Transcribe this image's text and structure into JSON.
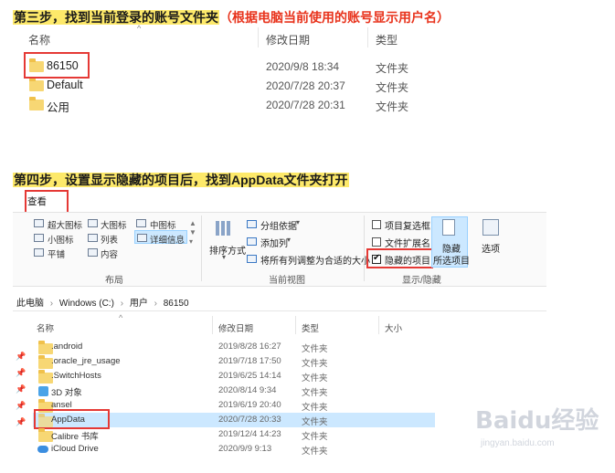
{
  "step3": {
    "title": "第三步，找到当前登录的账号文件夹",
    "note": "（根据电脑当前使用的账号显示用户名）"
  },
  "explorer1": {
    "columns": {
      "name": "名称",
      "date": "修改日期",
      "type": "类型"
    },
    "rows": [
      {
        "name": "86150",
        "date": "2020/9/8 18:34",
        "type": "文件夹"
      },
      {
        "name": "Default",
        "date": "2020/7/28 20:37",
        "type": "文件夹"
      },
      {
        "name": "公用",
        "date": "2020/7/28 20:31",
        "type": "文件夹"
      }
    ]
  },
  "step4": {
    "title": "第四步，设置显示隐藏的项目后，找到AppData文件夹打开"
  },
  "ribbon": {
    "tab_view": "查看",
    "layout": {
      "items": [
        "超大图标",
        "大图标",
        "中图标",
        "小图标",
        "列表",
        "详细信息",
        "平铺",
        "内容"
      ],
      "group_label": "布局"
    },
    "current_view": {
      "sort_by": "排序方式",
      "group_by": "分组依据",
      "add_column": "添加列",
      "size_all_columns": "将所有列调整为合适的大小",
      "group_label": "当前视图"
    },
    "show_hide": {
      "item_checkboxes": "项目复选框",
      "file_extensions": "文件扩展名",
      "hidden_items": "隐藏的项目",
      "hide_selected_line1": "隐藏",
      "hide_selected_line2": "所选项目",
      "options": "选项",
      "group_label": "显示/隐藏"
    }
  },
  "breadcrumb": [
    "此电脑",
    "Windows (C:)",
    "用户",
    "86150"
  ],
  "explorer2": {
    "columns": {
      "name": "名称",
      "date": "修改日期",
      "type": "类型",
      "size": "大小"
    },
    "rows": [
      {
        "name": ".android",
        "date": "2019/8/28 16:27",
        "type": "文件夹"
      },
      {
        "name": ".oracle_jre_usage",
        "date": "2019/7/18 17:50",
        "type": "文件夹"
      },
      {
        "name": ".SwitchHosts",
        "date": "2019/6/25 14:14",
        "type": "文件夹"
      },
      {
        "name": "3D 对象",
        "date": "2020/8/14 9:34",
        "type": "文件夹"
      },
      {
        "name": "ansel",
        "date": "2019/6/19 20:40",
        "type": "文件夹"
      },
      {
        "name": "AppData",
        "date": "2020/7/28 20:33",
        "type": "文件夹"
      },
      {
        "name": "Calibre 书库",
        "date": "2019/12/4 14:23",
        "type": "文件夹"
      },
      {
        "name": "iCloud Drive",
        "date": "2020/9/9 9:13",
        "type": "文件夹"
      }
    ]
  },
  "watermark": {
    "brand": "Baidu经验",
    "url": "jingyan.baidu.com"
  }
}
